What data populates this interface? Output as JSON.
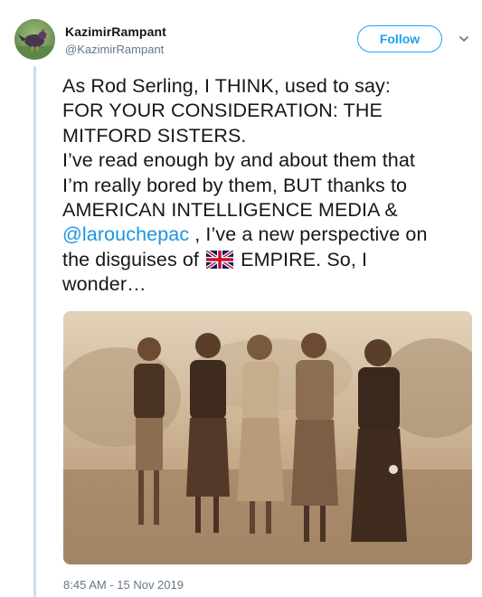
{
  "tweet": {
    "author_name": "KazimirRampant",
    "author_handle": "@KazimirRampant",
    "follow_label": "Follow",
    "text_lines": [
      "As Rod Serling, I THINK, used to say:",
      "FOR YOUR CONSIDERATION:  THE",
      "MITFORD SISTERS.",
      "I’ve read enough by and about them that",
      "I’m really bored by them, BUT thanks to",
      "AMERICAN INTELLIGENCE MEDIA &"
    ],
    "mention": "@larouchepac",
    "mention_suffix": " , I’ve a new perspective on",
    "line8_prefix": "the disguises of ",
    "line8_suffix": " EMPIRE. So, I",
    "line9": "wonder…",
    "timestamp": "8:45 AM - 15 Nov 2019"
  },
  "icons": {
    "avatar": "bird-avatar-icon",
    "menu": "chevron-down-icon",
    "flag": "uk-flag-icon"
  },
  "colors": {
    "accent": "#1da1f2",
    "mention": "#1b95e0",
    "thread_line": "#c4dff4",
    "secondary_text": "#657786",
    "primary_text": "#14171a"
  }
}
